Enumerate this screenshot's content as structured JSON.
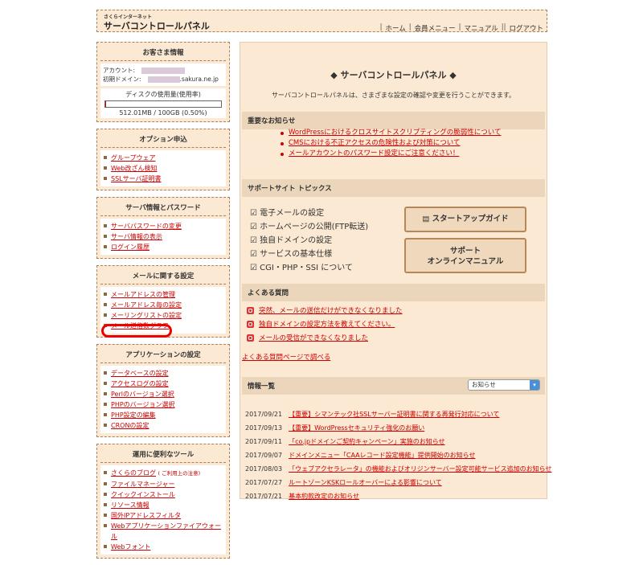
{
  "header": {
    "logo_sub": "さくらインターネット",
    "logo_main": "サーバコントロールパネル",
    "nav": [
      "ホーム",
      "会員メニュー",
      "マニュアル",
      "ログアウト"
    ]
  },
  "sidebar": {
    "customer": {
      "title": "お客さま情報",
      "account_label": "アカウント:",
      "domain_label": "初期ドメイン:",
      "domain_suffix": ".sakura.ne.jp",
      "disk_title": "ディスクの使用量(使用率)",
      "disk_value": "512.01MB / 100GB (0.50%)",
      "disk_fraction": 0.005
    },
    "options": {
      "title": "オプション申込",
      "items": [
        "グループウェア",
        "Web改ざん検知",
        "SSLサーバ証明書"
      ]
    },
    "server": {
      "title": "サーバ情報とパスワード",
      "items": [
        "サーバパスワードの変更",
        "サーバ情報の表示",
        "ログイン履歴"
      ]
    },
    "mail": {
      "title": "メールに関する設定",
      "items": [
        "メールアドレスの管理",
        "メールアドレス毎の設定",
        "メーリングリストの設定",
        "メール送信数グラフ"
      ]
    },
    "app": {
      "title": "アプリケーションの設定",
      "items": [
        "データベースの設定",
        "アクセスログの設定",
        "Perlのバージョン選択",
        "PHPのバージョン選択",
        "PHP設定の編集",
        "CRONの設定"
      ]
    },
    "tools": {
      "title": "運用に便利なツール",
      "blog": "さくらのブログ",
      "blog_note": "( ご利用上の注意)",
      "items": [
        "ファイルマネージャー",
        "クイックインストール",
        "リソース情報",
        "国外IPアドレスフィルタ",
        "Webアプリケーションファイアウォール",
        "Webフォント"
      ]
    }
  },
  "main": {
    "title": "◆ サーバコントロールパネル ◆",
    "desc": "サーバコントロールパネルは、さまざまな設定の確認や変更を行うことができます。",
    "notice_title": "重要なお知らせ",
    "notices": [
      "WordPressにおけるクロスサイトスクリプティングの脆弱性について",
      "CMSにおける不正アクセスの危険性および対策について",
      "メールアカウントのパスワード設定にご注意ください！"
    ],
    "support_title": "サポートサイト トピックス",
    "support_items": [
      "電子メールの設定",
      "ホームページの公開(FTP転送)",
      "独自ドメインの設定",
      "サービスの基本仕様",
      "CGI・PHP・SSI について"
    ],
    "startup_btn": "スタートアップガイド",
    "manual_btn1": "サポート",
    "manual_btn2": "オンラインマニュアル",
    "faq_title": "よくある質問",
    "faqs": [
      "突然、メールの送信だけができなくなりました",
      "独自ドメインの設定方法を教えてください。",
      "メールの受信ができなくなりました"
    ],
    "faq_more": "よくある質問ページで調べる",
    "news_title": "情報一覧",
    "news_select": "お知らせ",
    "news": [
      {
        "date": "2017/09/21",
        "text": "【重要】シマンテック社SSLサーバー証明書に関する再発行対応について"
      },
      {
        "date": "2017/09/13",
        "text": "【重要】WordPressセキュリティ強化のお願い"
      },
      {
        "date": "2017/09/11",
        "text": "「co.jpドメインご契約キャンペーン」実施のお知らせ"
      },
      {
        "date": "2017/09/07",
        "text": "ドメインメニュー「CAAレコード設定機能」提供開始のお知らせ"
      },
      {
        "date": "2017/08/03",
        "text": "「ウェブアクセラレータ」の機能およびオリジンサーバー設定可能サービス追加のお知らせ"
      },
      {
        "date": "2017/07/27",
        "text": "ルートゾーンKSKロールオーバーによる影響について"
      },
      {
        "date": "2017/07/21",
        "text": "基本約款改定のお知らせ"
      }
    ]
  }
}
